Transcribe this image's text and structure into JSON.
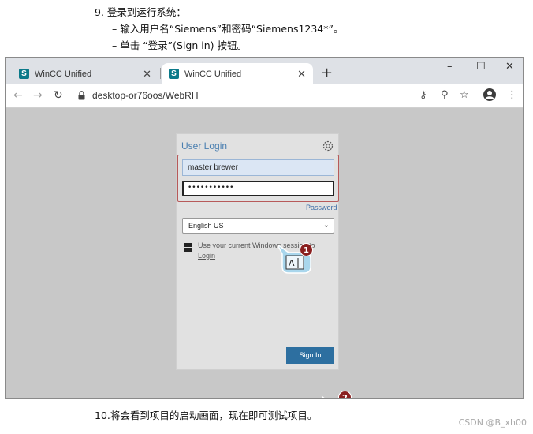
{
  "instructions": {
    "step9": "9. 登录到运行系统：",
    "sub1": "–  输入用户名“Siemens”和密码“Siemens1234*”。",
    "sub2": "–  单击 “登录”(Sign in) 按钮。",
    "step10": "10.将会看到项目的启动画面，现在即可测试项目。"
  },
  "watermark": "CSDN @B_xh00",
  "browser": {
    "tabs": [
      {
        "favicon": "S",
        "label": "WinCC Unified",
        "close": "✕"
      },
      {
        "favicon": "S",
        "label": "WinCC Unified",
        "close": "✕"
      }
    ],
    "new_tab": "+",
    "window_controls": {
      "minimize": "–",
      "maximize": "☐",
      "close": "✕"
    },
    "url": "desktop-or76oos/WebRH",
    "icons": [
      "back-icon",
      "forward-icon",
      "reload-icon",
      "lock-icon",
      "key-icon",
      "zoom-icon",
      "star-icon",
      "profile-icon",
      "menu-icon"
    ]
  },
  "login": {
    "title": "User Login",
    "username_value": "master brewer",
    "password_value": "•••••••••••",
    "forgot_password": "Password",
    "language": "English US",
    "windows_link": "Use your current Windows session to Login",
    "sign_in": "Sign In"
  },
  "callouts": [
    {
      "number": "1",
      "icon": "text-cursor-icon"
    },
    {
      "number": "2",
      "icon": "mouse-icon"
    }
  ],
  "colors": {
    "accent": "#2d6fa0",
    "title_blue": "#4a7fb0",
    "highlight_border": "#b75a5a",
    "badge": "#8a1f1f",
    "favicon": "#0b7a8a"
  }
}
